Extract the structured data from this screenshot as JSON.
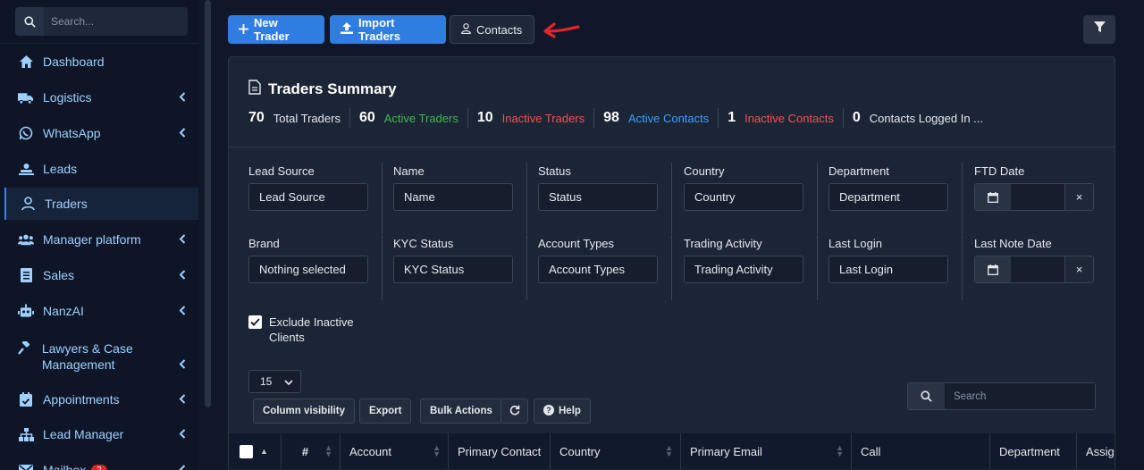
{
  "sidebar": {
    "search_placeholder": "Search...",
    "items": [
      {
        "label": "Dashboard"
      },
      {
        "label": "Logistics"
      },
      {
        "label": "WhatsApp"
      },
      {
        "label": "Leads"
      },
      {
        "label": "Traders"
      },
      {
        "label": "Manager platform"
      },
      {
        "label": "Sales"
      },
      {
        "label": "NanzAI"
      },
      {
        "label": "Lawyers & Case Management"
      },
      {
        "label": "Appointments"
      },
      {
        "label": "Lead Manager"
      },
      {
        "label": "Mailbox",
        "badge": "2"
      }
    ]
  },
  "toolbar": {
    "new_trader": "New Trader",
    "import_traders": "Import Traders",
    "contacts": "Contacts"
  },
  "summary": {
    "title": "Traders Summary",
    "stats": [
      {
        "count": "70",
        "label": "Total Traders",
        "color": "#e6e9ee"
      },
      {
        "count": "60",
        "label": "Active Traders",
        "color": "#3fb950"
      },
      {
        "count": "10",
        "label": "Inactive Traders",
        "color": "#f05252"
      },
      {
        "count": "98",
        "label": "Active Contacts",
        "color": "#3b9eff"
      },
      {
        "count": "1",
        "label": "Inactive Contacts",
        "color": "#f05252"
      },
      {
        "count": "0",
        "label": "Contacts Logged In ...",
        "color": "#e6e9ee"
      }
    ]
  },
  "filters": {
    "row1": [
      {
        "label": "Lead Source",
        "value": "Lead Source"
      },
      {
        "label": "Name",
        "value": "Name"
      },
      {
        "label": "Status",
        "value": "Status"
      },
      {
        "label": "Country",
        "value": "Country"
      },
      {
        "label": "Department",
        "value": "Department"
      },
      {
        "label": "FTD Date"
      }
    ],
    "row2": [
      {
        "label": "Brand",
        "value": "Nothing selected"
      },
      {
        "label": "KYC Status",
        "value": "KYC Status"
      },
      {
        "label": "Account Types",
        "value": "Account Types"
      },
      {
        "label": "Trading Activity",
        "value": "Trading Activity"
      },
      {
        "label": "Last Login",
        "value": "Last Login"
      },
      {
        "label": "Last Note Date"
      }
    ],
    "exclude_inactive": "Exclude Inactive Clients",
    "clear": "×"
  },
  "table_controls": {
    "page_size": "15",
    "column_visibility": "Column visibility",
    "export": "Export",
    "bulk_actions": "Bulk Actions",
    "help": "Help",
    "search_placeholder": "Search"
  },
  "table": {
    "columns": [
      "#",
      "Account",
      "Primary Contact",
      "Country",
      "Primary Email",
      "Call",
      "Department",
      "Assig"
    ]
  }
}
